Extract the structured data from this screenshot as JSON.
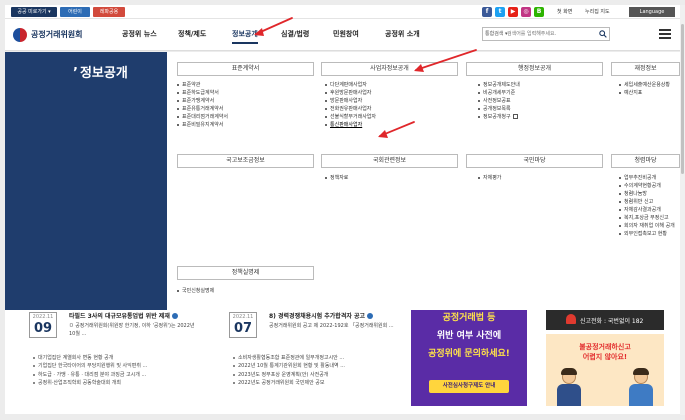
{
  "topbar": {
    "tabs": [
      "공공 미로가기 ▾",
      "어린이",
      "레파공용"
    ],
    "sns": [
      "f",
      "t",
      "▶",
      "◎",
      "B"
    ],
    "links": [
      "첫 화면",
      "누리집 지도"
    ],
    "language": "Language"
  },
  "header": {
    "logo_text": "공정거래위원회",
    "nav": [
      "공정위 뉴스",
      "정책/제도",
      "정보공개",
      "심결/법령",
      "민원창여",
      "공정위 소개"
    ],
    "search": {
      "select": "통합검색 ▾",
      "placeholder": "검색어를 입력해주세요."
    }
  },
  "mega": {
    "title": "정보공개",
    "sections": {
      "standard": {
        "title": "표준계약서",
        "items": [
          "표준약관",
          "표준하도급계약서",
          "표준가맹계약서",
          "표준유통거래계약서",
          "표준대리점거래계약서",
          "표준비밀유지계약서"
        ]
      },
      "admin": {
        "title": "사업자정보공개",
        "items": [
          "다단계판매사업자",
          "후원방문판매사업자",
          "방문판매사업자",
          "전화권유판매사업자",
          "선불식할부거래사업자",
          "통신판매사업자"
        ]
      },
      "info": {
        "title": "행정정보공개",
        "items": [
          "정보공개제도안내",
          "비공개세부기준",
          "사전정보공표",
          "공개정보목록",
          "정보공개청구"
        ]
      },
      "finance": {
        "title": "재정정보",
        "items": [
          "세입세출예산운용상황",
          "예산지표"
        ]
      },
      "national": {
        "title": "국고보조금정보",
        "items": []
      },
      "assembly": {
        "title": "국회관련정보",
        "items": [
          "정책자료"
        ]
      },
      "citizen": {
        "title": "국민마당",
        "items": [
          "자체평가"
        ]
      },
      "clean": {
        "title": "청렴마당",
        "items": [
          "업무추진비공개",
          "수의계약현황공개",
          "청렴나눔방",
          "청렴위반 신고",
          "자체감사결과공개",
          "복지,포상금 부정신고",
          "회의자 재취업 이해 공개",
          "외부인접촉보고 현황"
        ]
      },
      "policy": {
        "title": "정책실명제",
        "items": [
          "국민신청실명제"
        ]
      }
    }
  },
  "news": {
    "left": {
      "date_ym": "2022.11",
      "date_d": "09",
      "title": "타필드 3사의 대규모유통업법 위반 제재",
      "sub": "ㅁ 공정거래위원회(위원장 한기정, 이하 '공정위')는 2022년 10월 ...",
      "items": [
        "대기업집단 계열회사 변동 현황 공개",
        "기업집단 한국타이어의 부당지원행위 및 사익편취 ...",
        "하도급 · 가맹 · 유통 · 대리점 분야 과징금 고시개 ...",
        "공정위·산업조직학회 공동학술대회 개최"
      ]
    },
    "middle": {
      "date_ym": "2022.11",
      "date_d": "07",
      "title": "8) 경력경쟁채용시험 추가합격자 공고",
      "sub": "공정거래위원회 공고 제 2022-192호 「공정거래위원회 ...",
      "items": [
        "소비자생활협동조합 표준정관에 일부개정고시안 ...",
        "2022년 10월 통계기관위원회 현황 및 활동내역 ...",
        "2023년도 정부포상 운영계획(안) 사전공개",
        "2022년도 공정거래위원회 국민제안 공모"
      ]
    }
  },
  "banner": {
    "line1": "공정거래법 등",
    "line2": "위반 여부 사전에",
    "line3": "공정위에 문의하세요!",
    "button": "사전심사청구제도 안내"
  },
  "report": {
    "text": "신고전화 : 국번없이 182"
  },
  "warn": {
    "line1": "불공정거래하신고",
    "line2": "어렵지 않아요!"
  }
}
